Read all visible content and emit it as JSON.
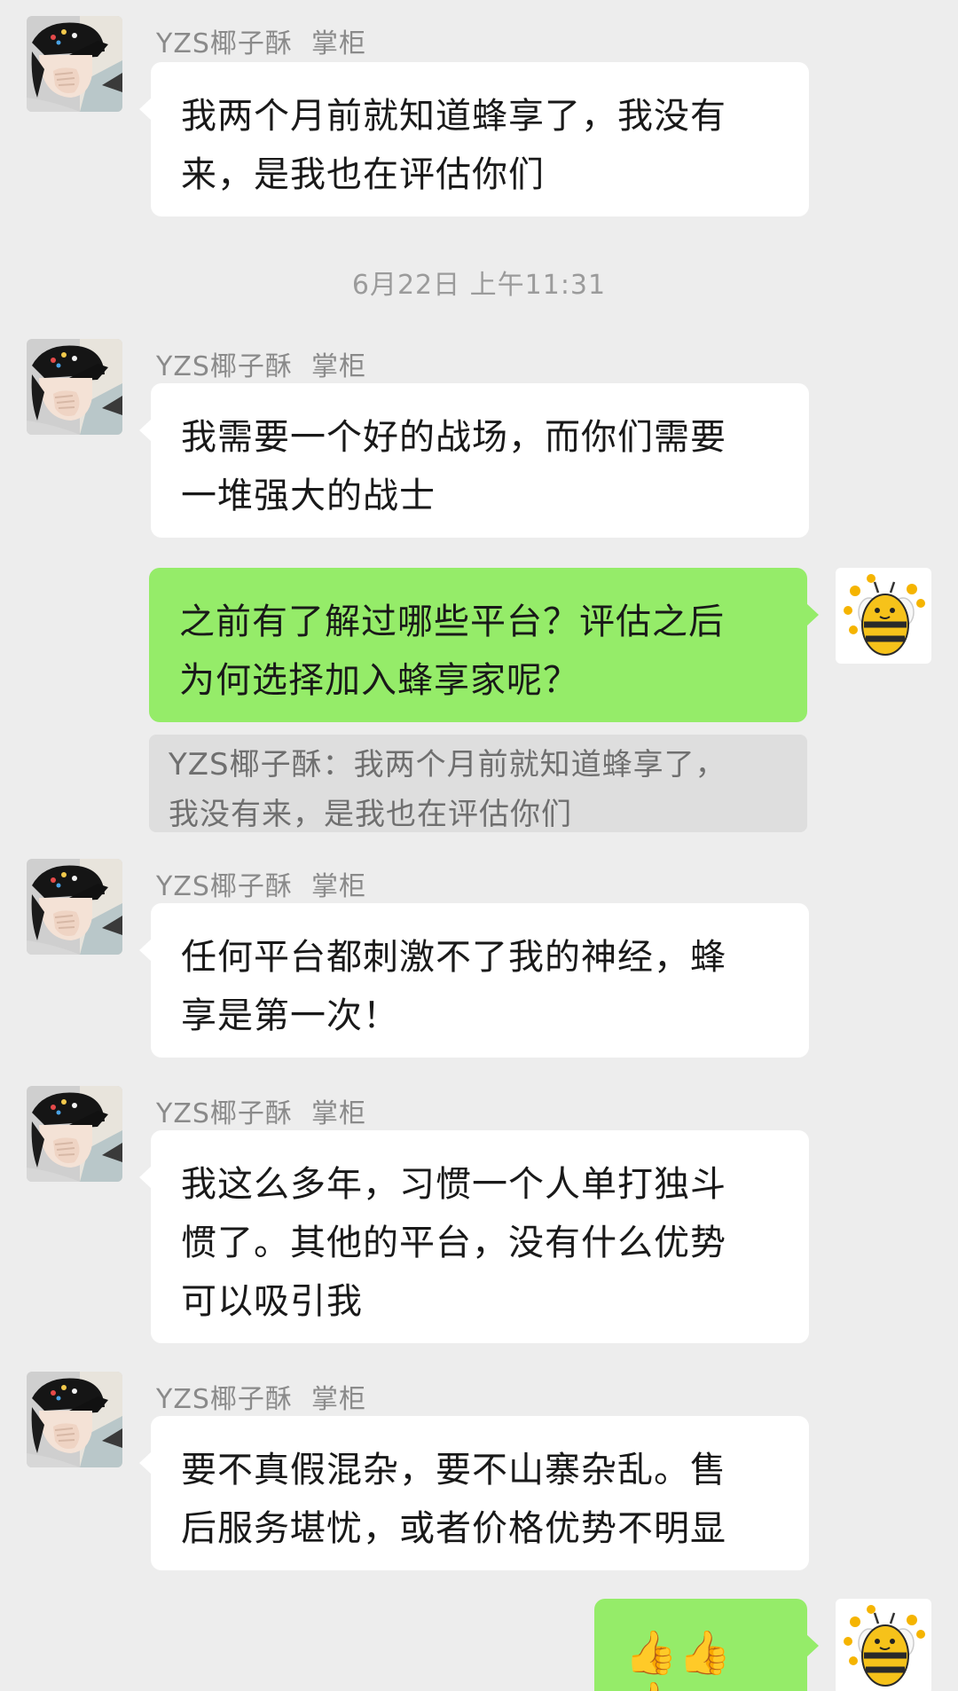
{
  "sender": {
    "name": "YZS椰子酥",
    "role": "掌柜"
  },
  "messages": [
    {
      "id": "m1",
      "lines": [
        "我两个月前就知道蜂享了，我没有",
        "来，是我也在评估你们"
      ]
    },
    {
      "id": "t1",
      "timestamp": "6月22日 上午11:31"
    },
    {
      "id": "m2",
      "lines": [
        "我需要一个好的战场，而你们需要",
        "一堆强大的战士"
      ]
    },
    {
      "id": "m3",
      "lines": [
        "之前有了解过哪些平台？评估之后",
        "为何选择加入蜂享家呢？"
      ],
      "quote_lines": [
        "YZS椰子酥：我两个月前就知道蜂享了，",
        "我没有来，是我也在评估你们"
      ]
    },
    {
      "id": "m4",
      "lines": [
        "任何平台都刺激不了我的神经，蜂",
        "享是第一次！"
      ]
    },
    {
      "id": "m5",
      "lines": [
        "我这么多年，习惯一个人单打独斗",
        "惯了。其他的平台，没有什么优势",
        "可以吸引我"
      ]
    },
    {
      "id": "m6",
      "lines": [
        "要不真假混杂，要不山寨杂乱。售",
        "后服务堪忧，或者价格优势不明显"
      ]
    },
    {
      "id": "m7",
      "emoji": "👍👍👍"
    }
  ],
  "icons": {
    "incoming_avatar": "user-photo-avatar",
    "outgoing_avatar": "bee-avatar"
  },
  "colors": {
    "background": "#ededed",
    "incoming_bubble": "#ffffff",
    "outgoing_bubble": "#95ec69",
    "quote_background": "#dedede"
  }
}
